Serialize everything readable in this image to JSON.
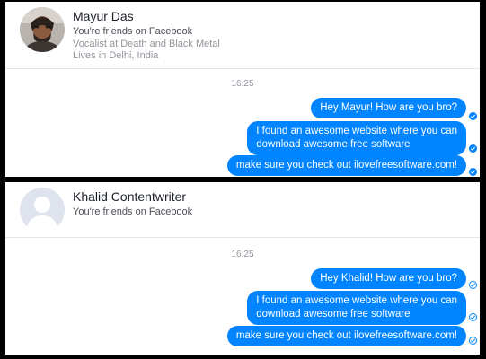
{
  "conversations": [
    {
      "name": "Mayur Das",
      "relationship": "You're friends on Facebook",
      "details": [
        "Vocalist at Death and Black Metal",
        "Lives in Delhi, India"
      ],
      "time": "16:25",
      "messages": [
        {
          "line1": "Hey Mayur! How are you bro?",
          "line2": "",
          "status": "seen"
        },
        {
          "line1": "I found an awesome website where you can",
          "line2": "download awesome free software",
          "status": "seen"
        },
        {
          "line1": "make sure you check out ilovefreesoftware.com!",
          "line2": "",
          "status": "seen"
        }
      ]
    },
    {
      "name": "Khalid Contentwriter",
      "relationship": "You're friends on Facebook",
      "details": [],
      "time": "16:25",
      "messages": [
        {
          "line1": "Hey Khalid! How are you bro?",
          "line2": "",
          "status": "sent"
        },
        {
          "line1": "I found an awesome website where you can",
          "line2": "download awesome free software",
          "status": "sent"
        },
        {
          "line1": "make sure you check out ilovefreesoftware.com!",
          "line2": "",
          "status": "sent"
        }
      ]
    }
  ],
  "colors": {
    "bubble": "#0084ff",
    "bubble_text": "#ffffff",
    "panel_bg": "#ffffff",
    "frame": "#000000"
  },
  "icons": {
    "seen": "check-circle-filled-icon",
    "sent": "check-circle-outline-icon"
  }
}
